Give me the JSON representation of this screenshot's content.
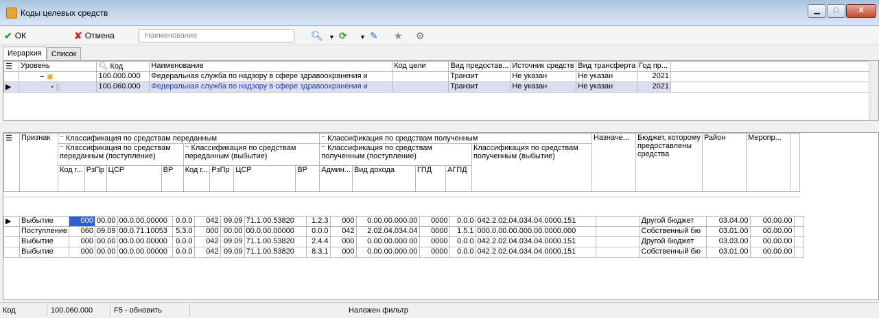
{
  "window": {
    "title": "Коды целевых средств",
    "min": "▁",
    "max": "□",
    "close": "X"
  },
  "toolbar": {
    "ok_label": "ОК",
    "cancel_label": "Отмена",
    "search_placeholder": "Наименование"
  },
  "tabs": [
    {
      "label": "Иерархия"
    },
    {
      "label": "Список"
    }
  ],
  "colors": {
    "accent": "#2f5fcf",
    "selected_row": "#dcdcf2",
    "link_text": "#1b3fb0"
  },
  "top_grid": {
    "headers": {
      "level": "Уровень",
      "code": "Код",
      "name": "Наименование",
      "goal_code": "Код цели",
      "prov_type": "Вид предостав...",
      "source": "Источник средств",
      "transfer": "Вид трансферта",
      "year": "Год пр..."
    },
    "rows": [
      {
        "code": "100.000.000",
        "name": "Федеральная служба по надзору в сфере здравоохранения и",
        "goal_code": "",
        "prov_type": "Транзит",
        "source": "Не указан",
        "transfer": "Не указан",
        "year": "2021"
      },
      {
        "code": "100.060.000",
        "name": "Федеральная служба по надзору в сфере здравоохранения и",
        "goal_code": "",
        "prov_type": "Транзит",
        "source": "Не указан",
        "transfer": "Не указан",
        "year": "2021"
      }
    ]
  },
  "bottom_grid": {
    "headers": {
      "sign": "Признак",
      "transferred": "Классификация по средствам переданным",
      "transferred_in": "Классификация по средствам переданным (поступление)",
      "transferred_out": "Классификация по средствам переданным (выбытие)",
      "received": "Классификация по средствам полученным",
      "received_in": "Классификация по средствам полученным (поступление)",
      "received_out": "Классификация по средствам полученным (выбытие)",
      "purpose": "Назначе...",
      "budget": "Бюджет, которому предоставлены средства",
      "district": "Район",
      "event": "Меропр...",
      "kod_g": "Код г...",
      "rzpr": "РзПр",
      "csr": "ЦСР",
      "vr": "ВР",
      "admin": "Админ...",
      "vid_doh": "Вид дохода",
      "gpd": "ГПД",
      "agpd": "АГПД"
    },
    "rows": [
      {
        "sign": "Выбытие",
        "kod1": "000",
        "rz1": "00.00",
        "csr1": "00.0.00.00000",
        "vr1": "0.0.0",
        "kod2": "042",
        "rz2": "09.09",
        "csr2": "71.1.00.53820",
        "vr2": "1.2.3",
        "admin": "000",
        "vid": "0.00.00.000.00",
        "gpd": "0000",
        "agpd": "0.0.0",
        "out": "042.2.02.04.034.04.0000.151",
        "purpose": "",
        "budget": "Другой бюджет",
        "district": "03.04.00",
        "event": "00.00.00"
      },
      {
        "sign": "Поступление",
        "kod1": "060",
        "rz1": "09.09",
        "csr1": "00.0.71.10053",
        "vr1": "5.3.0",
        "kod2": "000",
        "rz2": "00.00",
        "csr2": "00.0.00.00000",
        "vr2": "0.0.0",
        "admin": "042",
        "vid": "2.02.04.034.04",
        "gpd": "0000",
        "agpd": "1.5.1",
        "out": "000.0.00.00.000.00.0000.000",
        "purpose": "",
        "budget": "Собственный бю",
        "district": "03.01.00",
        "event": "00.00.00"
      },
      {
        "sign": "Выбытие",
        "kod1": "000",
        "rz1": "00.00",
        "csr1": "00.0.00.00000",
        "vr1": "0.0.0",
        "kod2": "042",
        "rz2": "09.09",
        "csr2": "71.1.00.53820",
        "vr2": "2.4.4",
        "admin": "000",
        "vid": "0.00.00.000.00",
        "gpd": "0000",
        "agpd": "0.0.0",
        "out": "042.2.02.04.034.04.0000.151",
        "purpose": "",
        "budget": "Другой бюджет",
        "district": "03.03.00",
        "event": "00.00.00"
      },
      {
        "sign": "Выбытие",
        "kod1": "000",
        "rz1": "00.00",
        "csr1": "00.0.00.00000",
        "vr1": "0.0.0",
        "kod2": "042",
        "rz2": "09.09",
        "csr2": "71.1.00.53820",
        "vr2": "8.3.1",
        "admin": "000",
        "vid": "0.00.00.000.00",
        "gpd": "0000",
        "agpd": "0.0.0",
        "out": "042.2.02.04.034.04.0000.151",
        "purpose": "",
        "budget": "Собственный бю",
        "district": "03.01.00",
        "event": "00.00.00"
      }
    ]
  },
  "status": {
    "label": "Код",
    "value": "100.060.000",
    "refresh": "F5 - обновить",
    "filter": "Наложен фильтр"
  }
}
